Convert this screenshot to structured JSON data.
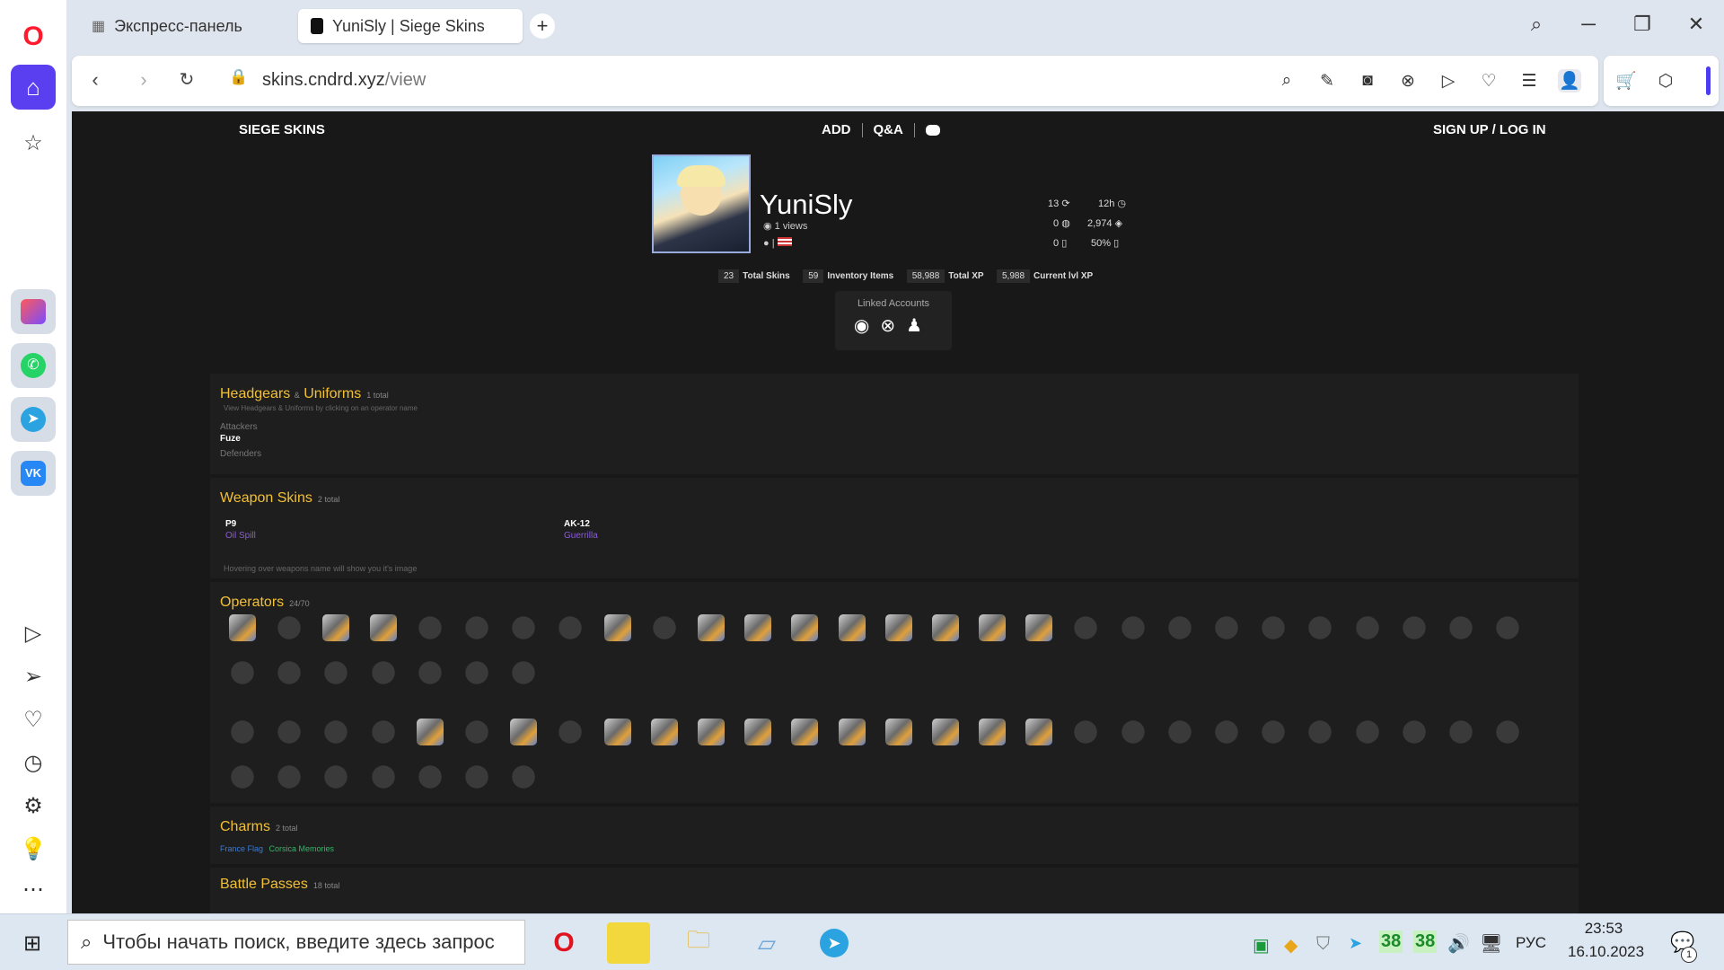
{
  "browser": {
    "tabs": [
      {
        "label": "Экспресс-панель",
        "active": false
      },
      {
        "label": "YuniSly | Siege Skins",
        "active": true
      }
    ],
    "url_host": "skins.cndrd.xyz",
    "url_path": "/view"
  },
  "site": {
    "brand": "SIEGE SKINS",
    "nav": [
      "ADD",
      "Q&A"
    ],
    "auth": "SIGN UP / LOG IN"
  },
  "profile": {
    "username": "YuniSly",
    "views": "1 views",
    "stats": {
      "level": "13",
      "playtime": "12h",
      "credits": "0",
      "renown": "2,974",
      "alpha_packs": "0",
      "pack_chance": "50%"
    },
    "badges": [
      {
        "value": "23",
        "label": "Total Skins"
      },
      {
        "value": "59",
        "label": "Inventory Items"
      },
      {
        "value": "58,988",
        "label": "Total XP"
      },
      {
        "value": "5,988",
        "label": "Current lvl XP"
      }
    ],
    "linked_title": "Linked Accounts"
  },
  "sections": {
    "headgears": {
      "title_a": "Headgears",
      "amp": "&",
      "title_b": "Uniforms",
      "total": "1 total",
      "hint": "View Headgears & Uniforms by clicking on an operator name",
      "attackers_label": "Attackers",
      "attacker_item": "Fuze",
      "defenders_label": "Defenders"
    },
    "weapons": {
      "title": "Weapon Skins",
      "total": "2 total",
      "items": [
        {
          "name": "P9",
          "skin": "Oil Spill"
        },
        {
          "name": "AK-12",
          "skin": "Guerrilla"
        }
      ],
      "hint": "Hovering over weapons name will show you it's image"
    },
    "operators": {
      "title": "Operators",
      "total": "24/70",
      "attackers_row": [
        1,
        0,
        1,
        1,
        0,
        0,
        0,
        0,
        1,
        0,
        1,
        1,
        1,
        1,
        1,
        1,
        1,
        1,
        0,
        0,
        0,
        0,
        0,
        0,
        0,
        0,
        0,
        0,
        0,
        0,
        0,
        0,
        0,
        0,
        0
      ],
      "defenders_row": [
        0,
        0,
        0,
        0,
        1,
        0,
        1,
        0,
        1,
        1,
        1,
        1,
        1,
        1,
        1,
        1,
        1,
        1,
        0,
        0,
        0,
        0,
        0,
        0,
        0,
        0,
        0,
        0,
        0,
        0,
        0,
        0,
        0,
        0,
        0
      ]
    },
    "charms": {
      "title": "Charms",
      "total": "2 total",
      "items": [
        "France Flag",
        "Corsica Memories"
      ]
    },
    "battlepasses": {
      "title": "Battle Passes",
      "total": "18 total"
    }
  },
  "taskbar": {
    "search_placeholder": "Чтобы начать поиск, введите здесь запрос",
    "temp1": "38",
    "temp2": "38",
    "lang": "РУС",
    "time": "23:53",
    "date": "16.10.2023",
    "notif_count": "1"
  },
  "colors": {
    "accent_gold": "#f3c033",
    "opera_red": "#ff1b2d",
    "sidebar_active": "#5a3ff0"
  }
}
